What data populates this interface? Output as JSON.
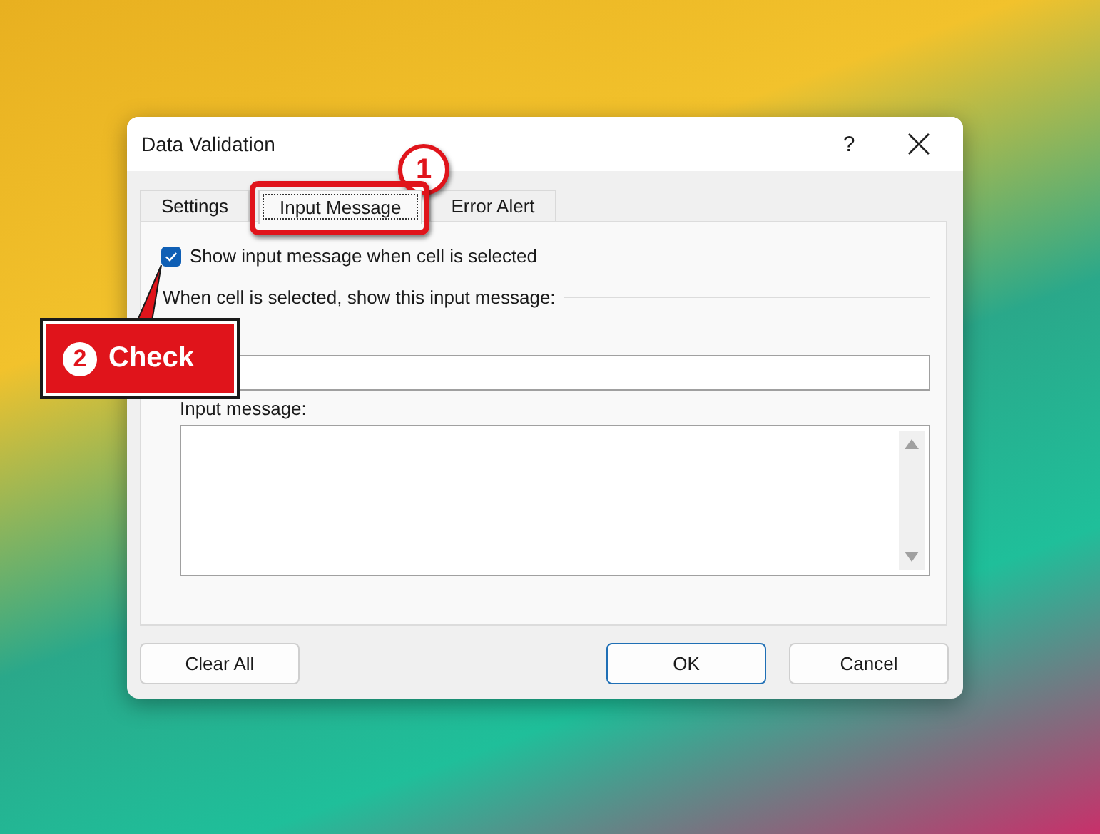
{
  "window": {
    "title": "Data Validation",
    "help": "?"
  },
  "tabs": [
    {
      "label": "Settings",
      "selected": false,
      "highlighted": false
    },
    {
      "label": "Input Message",
      "selected": true,
      "highlighted": true
    },
    {
      "label": "Error Alert",
      "selected": false,
      "highlighted": false
    }
  ],
  "show_message": {
    "label": "Show input message when cell is selected",
    "checked": true
  },
  "group_label": "When cell is selected, show this input message:",
  "input_message": {
    "label": "Input message:"
  },
  "buttons": [
    {
      "label": "Clear All",
      "default": false
    },
    {
      "label": "OK",
      "default": true
    },
    {
      "label": "Cancel",
      "default": false
    }
  ],
  "callouts": [
    {
      "number": "1"
    },
    {
      "number": "2",
      "label": "Check"
    }
  ]
}
